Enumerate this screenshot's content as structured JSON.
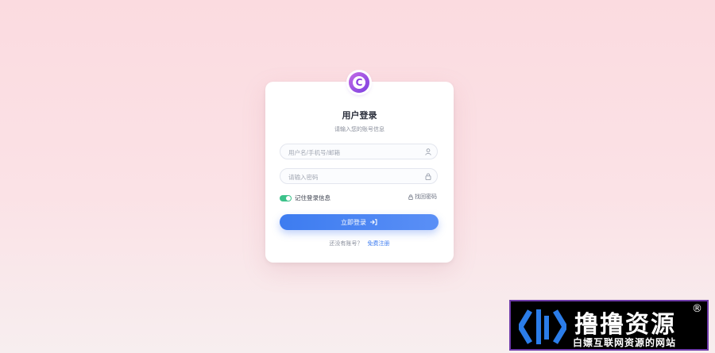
{
  "login": {
    "title": "用户登录",
    "subtitle": "请输入您的账号信息",
    "username_placeholder": "用户名/手机号/邮箱",
    "password_placeholder": "请输入密码",
    "remember_label": "记住登录信息",
    "remember_checked": true,
    "forgot_label": "找回密码",
    "submit_label": "立即登录",
    "signup_prompt": "还没有账号？",
    "signup_link": "免费注册"
  },
  "icons": {
    "logo": "copyright-c-logo-icon",
    "username": "user-icon",
    "password": "lock-icon",
    "forgot": "lock-icon",
    "submit": "sign-in-icon"
  },
  "watermark": {
    "main": "撸撸资源",
    "registered": "®",
    "sub": "白嫖互联网资源的网站"
  },
  "colors": {
    "accent": "#3d7cf0",
    "toggle_on": "#3cc28a",
    "logo": "#8b3fe0",
    "watermark_border": "#6d3aa8"
  }
}
